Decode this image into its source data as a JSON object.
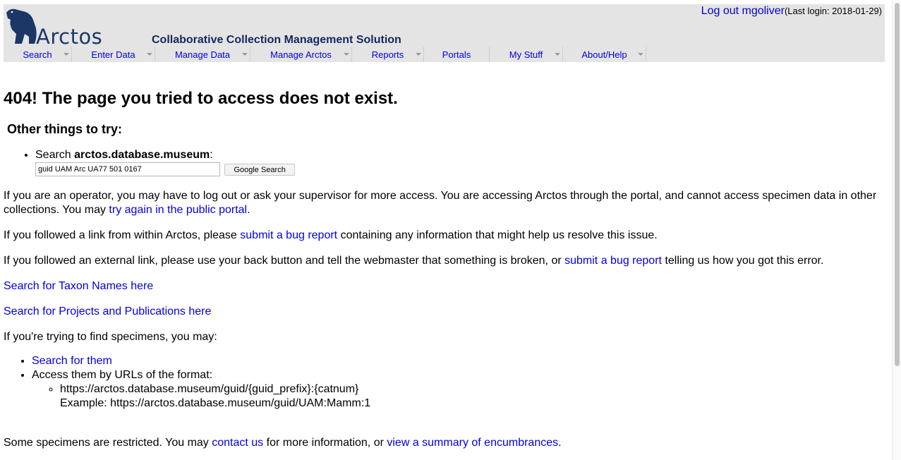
{
  "header": {
    "logo_text": "Arctos",
    "tagline": "Collaborative Collection Management Solution",
    "logout_link": "Log out mgoliver",
    "last_login": "(Last login: 2018-01-29)"
  },
  "nav": {
    "items": [
      {
        "label": "Search",
        "has_dropdown": true
      },
      {
        "label": "Enter Data",
        "has_dropdown": true
      },
      {
        "label": "Manage Data",
        "has_dropdown": true
      },
      {
        "label": "Manage Arctos",
        "has_dropdown": true
      },
      {
        "label": "Reports",
        "has_dropdown": true
      },
      {
        "label": "Portals",
        "has_dropdown": false
      },
      {
        "label": "My Stuff",
        "has_dropdown": true
      },
      {
        "label": "About/Help",
        "has_dropdown": true
      }
    ]
  },
  "content": {
    "heading": "404! The page you tried to access does not exist.",
    "subheading": "Other things to try:",
    "search": {
      "prefix": "Search ",
      "site": "arctos.database.museum",
      "suffix": ":",
      "input_value": "guid UAM Arc UA77 501 0167",
      "button_label": "Google Search"
    },
    "operator_text": "If you are an operator, you may have to log out or ask your supervisor for more access. You are accessing Arctos through the portal, and cannot access specimen data in other collections. You may ",
    "operator_link": "try again in the public portal",
    "operator_end": ".",
    "internal_text": "If you followed a link from within Arctos, please ",
    "internal_link": "submit a bug report",
    "internal_end": " containing any information that might help us resolve this issue.",
    "external_text": "If you followed an external link, please use your back button and tell the webmaster that something is broken, or ",
    "external_link": "submit a bug report",
    "external_end": " telling us how you got this error.",
    "taxon_link": "Search for Taxon Names here",
    "projects_link": "Search for Projects and Publications here",
    "find_text": "If you're trying to find specimens, you may:",
    "find_search_link": "Search for them",
    "find_urls_text": "Access them by URLs of the format:",
    "url_format": "https://arctos.database.museum/guid/{guid_prefix}:{catnum}",
    "url_example": "Example: https://arctos.database.museum/guid/UAM:Mamm:1",
    "restricted_text": "Some specimens are restricted. You may ",
    "contact_link": "contact us",
    "restricted_mid": " for more information, or ",
    "encumbrance_link": "view a summary of encumbrances",
    "restricted_end": "."
  },
  "colors": {
    "header_bg": "#e4e4e4",
    "link": "#0000e0",
    "logo": "#1c3766",
    "tagline": "#15275f"
  }
}
